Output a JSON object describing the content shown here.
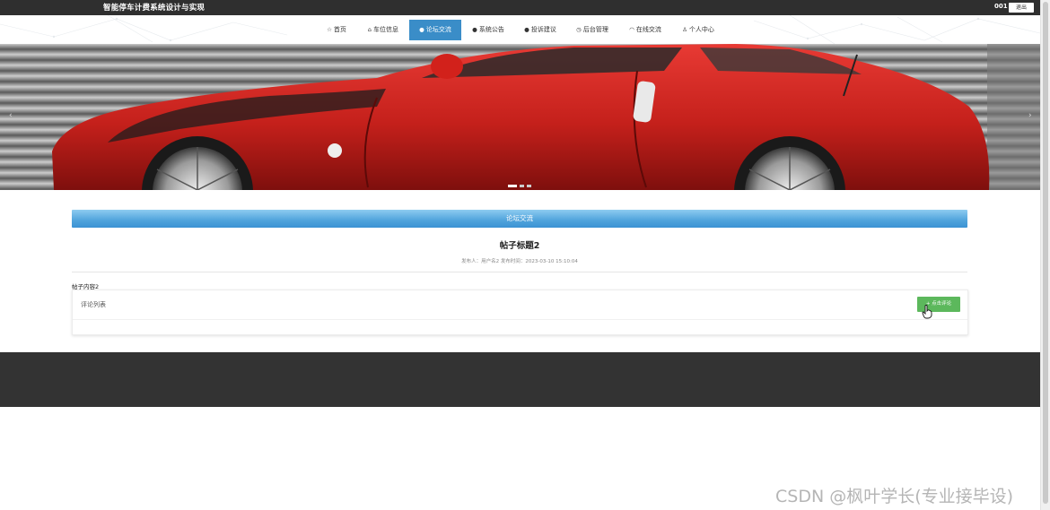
{
  "header": {
    "site_title": "智能停车计费系统设计与实现",
    "user_id": "001",
    "logout_label": "退出"
  },
  "nav": {
    "items": [
      {
        "label": "首页",
        "icon": "star-icon",
        "glyph": "☆"
      },
      {
        "label": "车位信息",
        "icon": "lock-icon",
        "glyph": "⌂"
      },
      {
        "label": "论坛交流",
        "icon": "info-circle-icon",
        "glyph": "●"
      },
      {
        "label": "系统公告",
        "icon": "question-circle-icon",
        "glyph": "●"
      },
      {
        "label": "投诉建议",
        "icon": "info-circle-icon",
        "glyph": "●"
      },
      {
        "label": "后台管理",
        "icon": "dashboard-icon",
        "glyph": "◷"
      },
      {
        "label": "在线交流",
        "icon": "headset-icon",
        "glyph": "◠"
      },
      {
        "label": "个人中心",
        "icon": "user-icon",
        "glyph": "♙"
      }
    ],
    "active_index": 2,
    "active_color": "#3a8dc8"
  },
  "banner": {
    "slide_count": 3,
    "active_slide": 1,
    "prev_glyph": "‹",
    "next_glyph": "›"
  },
  "forum": {
    "section_title": "论坛交流",
    "post_title": "帖子标题2",
    "meta": "发布人：用户名2   发布时间：2023-03-10 15:10:04",
    "content": "帖子内容2",
    "comment_list_label": "评论列表",
    "add_comment_label": "+ 点击评论"
  },
  "watermark": "CSDN @枫叶学长(专业接毕设)",
  "colors": {
    "topbar": "#2f2f2f",
    "footer": "#333333",
    "section_bar": "#4fa3dc",
    "comment_button": "#5cb85c"
  }
}
